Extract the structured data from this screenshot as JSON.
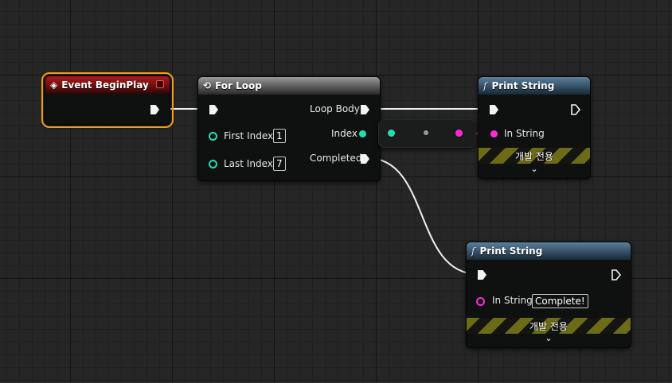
{
  "nodes": {
    "event_begin_play": {
      "title": "Event BeginPlay"
    },
    "for_loop": {
      "title": "For Loop",
      "inputs": {
        "first_index_label": "First Index",
        "first_index_value": "1",
        "last_index_label": "Last Index",
        "last_index_value": "7"
      },
      "outputs": {
        "loop_body_label": "Loop Body",
        "index_label": "Index",
        "completed_label": "Completed"
      }
    },
    "print_string_1": {
      "title": "Print String",
      "in_string_label": "In String",
      "dev_only_label": "개발 전용"
    },
    "print_string_2": {
      "title": "Print String",
      "in_string_label": "In String",
      "in_string_value": "Complete!",
      "dev_only_label": "개발 전용"
    }
  },
  "colors": {
    "exec": "#f2f2f2",
    "integer_pin": "#1fe0b0",
    "string_pin": "#ff2ad8",
    "selection": "#f29c1a",
    "event_header": "#b01a1a",
    "function_header": "#5b7f9b"
  },
  "icons": {
    "event": "event-diamond-icon",
    "loop": "loop-macro-icon",
    "function": "function-f-icon",
    "expand": "chevron-down-icon"
  }
}
